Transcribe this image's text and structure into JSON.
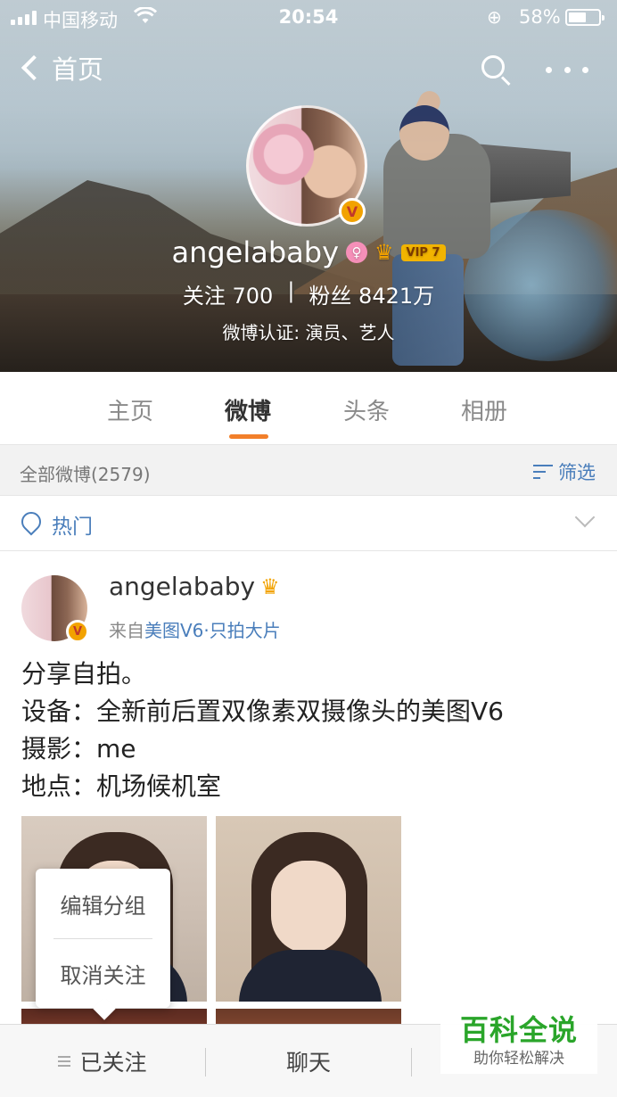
{
  "status_bar": {
    "carrier": "中国移动",
    "time": "20:54",
    "battery": "58%",
    "battery_level": 0.58
  },
  "nav": {
    "back_label": "首页",
    "icons": [
      "chevron-left-icon",
      "search-icon",
      "more-icon"
    ]
  },
  "profile": {
    "name": "angelababy",
    "vip_label": "VIP 7",
    "following_label": "关注",
    "following_count": "700",
    "separator": "|",
    "followers_label": "粉丝",
    "followers_count": "8421万",
    "verification": "微博认证: 演员、艺人",
    "badge": "V"
  },
  "tabs": [
    {
      "label": "主页",
      "active": false
    },
    {
      "label": "微博",
      "active": true
    },
    {
      "label": "头条",
      "active": false
    },
    {
      "label": "相册",
      "active": false
    }
  ],
  "filter_bar": {
    "count_label": "全部微博(2579)",
    "filter_label": "筛选"
  },
  "hot_row": {
    "label": "热门"
  },
  "post": {
    "username": "angelababy",
    "source_prefix": "来自",
    "source_link": "美图V6·只拍大片",
    "lines": [
      "分享自拍。",
      "设备：全新前后置双像素双摄像头的美图V6",
      "摄影：me",
      "地点：机场候机室"
    ]
  },
  "popup_menu": {
    "items": [
      "编辑分组",
      "取消关注"
    ]
  },
  "bottom_bar": {
    "following_label": "已关注",
    "chat_label": "聊天"
  },
  "watermark": {
    "title": "百科全说",
    "subtitle": "助你轻松解决"
  },
  "colors": {
    "accent_orange": "#f27f2a",
    "link_blue": "#4a7ebb",
    "vip_gold": "#f2b400",
    "watermark_green": "#2aa52a"
  }
}
